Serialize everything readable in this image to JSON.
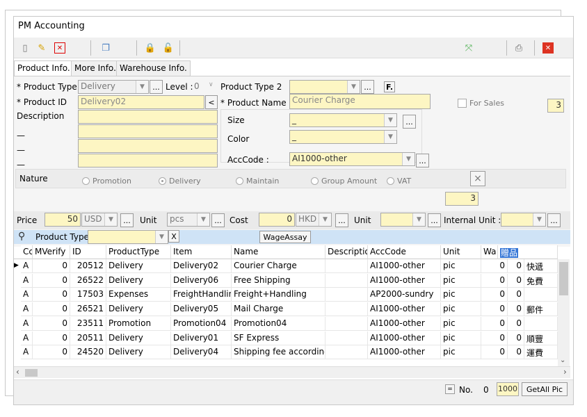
{
  "window": {
    "title": "PM Accounting"
  },
  "tabs": [
    "Product Info.",
    "More Info.",
    "Warehouse Info."
  ],
  "form": {
    "product_type_label": "* Product Type",
    "product_type_value": "Delivery",
    "level_label": "Level :",
    "level_value": "0",
    "product_type2_label": "Product Type 2",
    "f_button": "F.",
    "product_id_label": "* Product ID",
    "product_id_value": "Delivery02",
    "lt_button": "<",
    "product_name_label": "* Product Name",
    "product_name_value": "Courier Charge",
    "for_sales_label": "For Sales",
    "for_sales_count": "3",
    "description_label": "Description",
    "dash1": "—",
    "dash2": "—",
    "dash3": "—",
    "size_label": "Size",
    "size_value": "_",
    "color_label": "Color",
    "color_value": "_",
    "acccode_label": "AccCode :",
    "acccode_value": "AI1000-other",
    "nature_label": "Nature",
    "nature_options": [
      "Promotion",
      "Delivery",
      "Maintain",
      "Group Amount",
      "VAT"
    ],
    "nature_selected": "Delivery",
    "x_button": "×",
    "count_box": "3",
    "price_label": "Price",
    "price_value": "50",
    "price_currency": "USD",
    "unit_label": "Unit",
    "unit_value": "pcs",
    "cost_label": "Cost",
    "cost_value": "0",
    "cost_currency": "HKD",
    "unit2_label": "Unit",
    "internal_unit_label": "Internal Unit :",
    "ellipsis": "..."
  },
  "filter": {
    "label": "Product Type",
    "x_button": "X",
    "wage_button": "WageAssay"
  },
  "grid": {
    "columns": [
      "Cc",
      "MVerify",
      "ID",
      "ProductType",
      "Item",
      "Name",
      "Descriptio",
      "AccCode",
      "Unit",
      "Wa",
      "贈品"
    ],
    "rows": [
      [
        "A",
        "0",
        "20512",
        "Delivery",
        "Delivery02",
        "Courier Charge",
        "",
        "AI1000-other",
        "pic",
        "0",
        "0",
        "快遞"
      ],
      [
        "A",
        "0",
        "26522",
        "Delivery",
        "Delivery06",
        "Free Shipping",
        "",
        "AI1000-other",
        "pic",
        "0",
        "0",
        "免費"
      ],
      [
        "A",
        "0",
        "17503",
        "Expenses",
        "FreightHandlin",
        "Freight+Handling",
        "",
        "AP2000-sundry",
        "pic",
        "0",
        "0",
        ""
      ],
      [
        "A",
        "0",
        "26521",
        "Delivery",
        "Delivery05",
        "Mail Charge",
        "",
        "AI1000-other",
        "pic",
        "0",
        "0",
        "郵件"
      ],
      [
        "A",
        "0",
        "23511",
        "Promotion",
        "Promotion04",
        "Promotion04",
        "",
        "AI1000-other",
        "pic",
        "0",
        "0",
        ""
      ],
      [
        "A",
        "0",
        "20511",
        "Delivery",
        "Delivery01",
        "SF Express",
        "",
        "AI1000-other",
        "pic",
        "0",
        "0",
        "順豐"
      ],
      [
        "A",
        "0",
        "24520",
        "Delivery",
        "Delivery04",
        "Shipping fee according",
        "",
        "AI1000-other",
        "pic",
        "0",
        "0",
        "運費"
      ]
    ]
  },
  "footer": {
    "no_label": "No.",
    "no_value": "0",
    "count_value": "1000",
    "get_all_pic": "GetAll Pic"
  },
  "colors": {
    "input_bg": "#fdf6c3",
    "header_blue": "#cfe3f6",
    "selected_header": "#3375d6"
  }
}
